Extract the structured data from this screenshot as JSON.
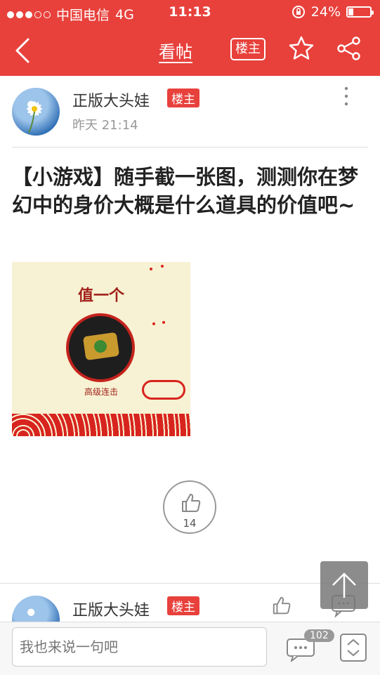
{
  "status": {
    "carrier": "中国电信",
    "network": "4G",
    "time": "11:13",
    "battery": "24%",
    "battery_fraction": 0.24
  },
  "nav": {
    "title": "看帖",
    "owner_label": "楼主"
  },
  "post": {
    "author": "正版大头娃",
    "owner_tag": "楼主",
    "time": "昨天 21:14",
    "title": "【小游戏】随手截一张图，测测你在梦幻中的身价大概是什么道具的价值吧~",
    "image": {
      "caption": "值一个",
      "sub_caption": "高级连击"
    },
    "likes": "14"
  },
  "reply": {
    "author": "正版大头娃",
    "owner_tag": "楼主"
  },
  "bottom": {
    "input_placeholder": "我也来说一句吧",
    "comment_count": "102"
  },
  "colors": {
    "accent": "#e8413c",
    "text": "#333333",
    "muted": "#999999"
  }
}
